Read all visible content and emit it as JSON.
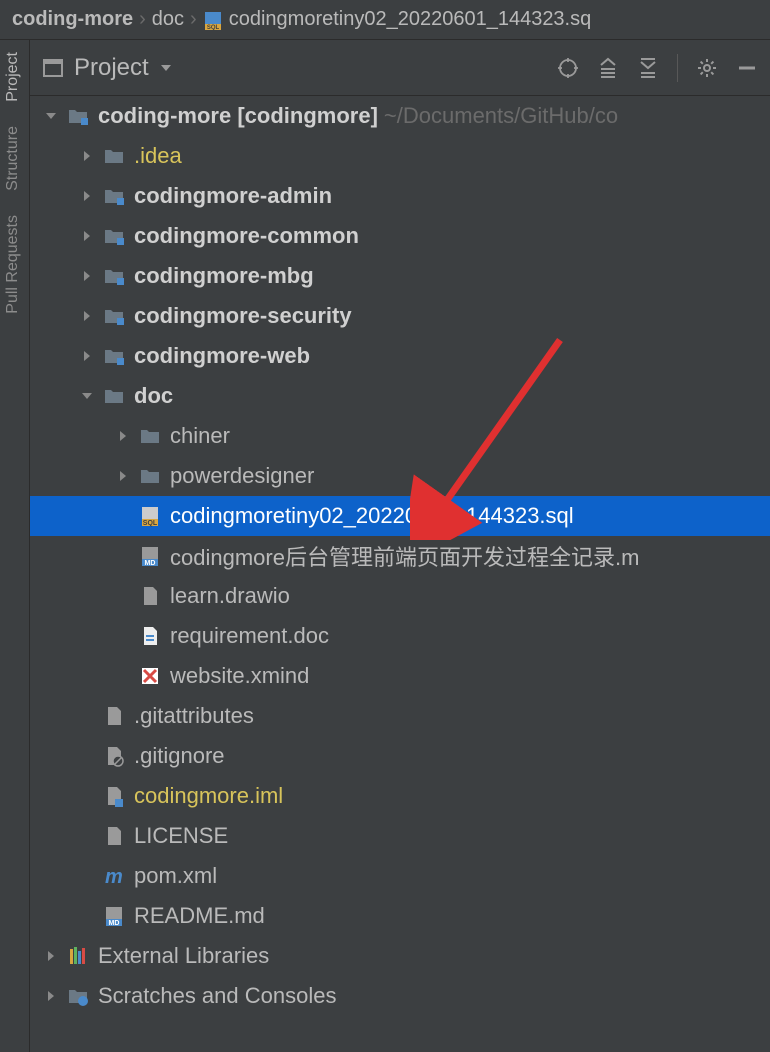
{
  "breadcrumb": {
    "root": "coding-more",
    "dir": "doc",
    "file": "codingmoretiny02_20220601_144323.sq"
  },
  "toolbar": {
    "view_label": "Project"
  },
  "side_tabs": {
    "project": "Project",
    "structure": "Structure",
    "pull_requests": "Pull Requests"
  },
  "tree": {
    "root": {
      "name": "coding-more",
      "module": "[codingmore]",
      "path": "~/Documents/GitHub/co"
    },
    "idea": ".idea",
    "modules": [
      "codingmore-admin",
      "codingmore-common",
      "codingmore-mbg",
      "codingmore-security",
      "codingmore-web"
    ],
    "doc": "doc",
    "doc_dirs": [
      "chiner",
      "powerdesigner"
    ],
    "doc_files": [
      {
        "name": "codingmoretiny02_20220601_144323.sql",
        "icon": "sql",
        "selected": true
      },
      {
        "name": "codingmore后台管理前端页面开发过程全记录.m",
        "icon": "md"
      },
      {
        "name": "learn.drawio",
        "icon": "file"
      },
      {
        "name": "requirement.doc",
        "icon": "doc"
      },
      {
        "name": "website.xmind",
        "icon": "xmind"
      }
    ],
    "root_files": [
      {
        "name": ".gitattributes",
        "icon": "file"
      },
      {
        "name": ".gitignore",
        "icon": "gitignore"
      },
      {
        "name": "codingmore.iml",
        "icon": "iml",
        "yellow": true
      },
      {
        "name": "LICENSE",
        "icon": "file"
      },
      {
        "name": "pom.xml",
        "icon": "maven"
      },
      {
        "name": "README.md",
        "icon": "md"
      }
    ],
    "external": "External Libraries",
    "scratches": "Scratches and Consoles"
  }
}
